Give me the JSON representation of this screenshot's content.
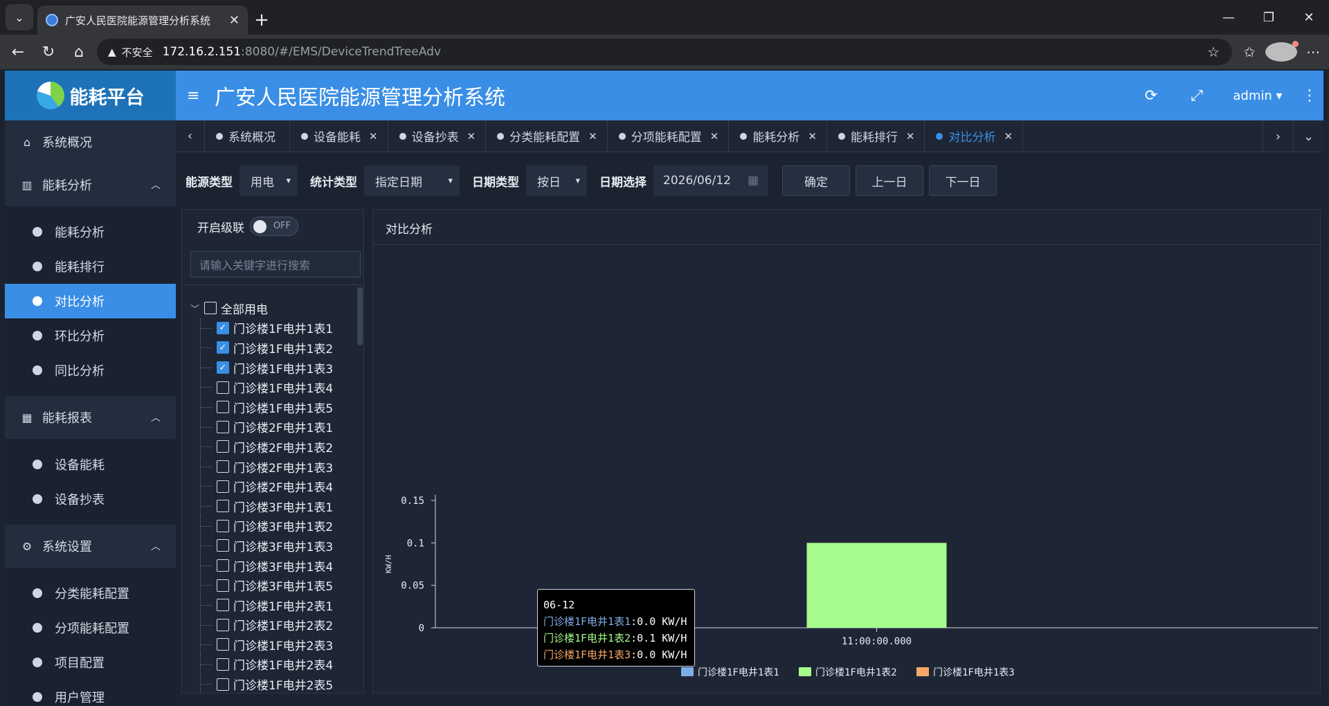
{
  "browser": {
    "tab_title": "广安人民医院能源管理分析系统",
    "insecure_label": "不安全",
    "url_host": "172.16.2.151",
    "url_path": ":8080/#/EMS/DeviceTrendTreeAdv"
  },
  "app": {
    "logo_text": "能耗平台",
    "system_name": "广安人民医院能源管理分析系统",
    "user": "admin"
  },
  "sidebar": {
    "overview": "系统概况",
    "groups": [
      {
        "label": "能耗分析",
        "icon": "bar-chart-icon",
        "items": [
          "能耗分析",
          "能耗排行",
          "对比分析",
          "环比分析",
          "同比分析"
        ],
        "active": "对比分析"
      },
      {
        "label": "能耗报表",
        "icon": "table-icon",
        "items": [
          "设备能耗",
          "设备抄表"
        ]
      },
      {
        "label": "系统设置",
        "icon": "gear-icon",
        "items": [
          "分类能耗配置",
          "分项能耗配置",
          "项目配置",
          "用户管理"
        ]
      }
    ]
  },
  "page_tabs": [
    "系统概况",
    "设备能耗",
    "设备抄表",
    "分类能耗配置",
    "分项能耗配置",
    "能耗分析",
    "能耗排行",
    "对比分析"
  ],
  "active_page_tab": "对比分析",
  "filter": {
    "energy_type_label": "能源类型",
    "energy_type": "用电",
    "stat_type_label": "统计类型",
    "stat_type": "指定日期",
    "date_type_label": "日期类型",
    "date_type": "按日",
    "date_label": "日期选择",
    "date": "2026/06/12",
    "confirm": "确定",
    "prev": "上一日",
    "next": "下一日"
  },
  "tree": {
    "cascade_label": "开启级联",
    "toggle": "OFF",
    "search_placeholder": "请输入关键字进行搜索",
    "root": "全部用电",
    "nodes": [
      {
        "label": "门诊楼1F电井1表1",
        "checked": true
      },
      {
        "label": "门诊楼1F电井1表2",
        "checked": true
      },
      {
        "label": "门诊楼1F电井1表3",
        "checked": true
      },
      {
        "label": "门诊楼1F电井1表4",
        "checked": false
      },
      {
        "label": "门诊楼1F电井1表5",
        "checked": false
      },
      {
        "label": "门诊楼2F电井1表1",
        "checked": false
      },
      {
        "label": "门诊楼2F电井1表2",
        "checked": false
      },
      {
        "label": "门诊楼2F电井1表3",
        "checked": false
      },
      {
        "label": "门诊楼2F电井1表4",
        "checked": false
      },
      {
        "label": "门诊楼3F电井1表1",
        "checked": false
      },
      {
        "label": "门诊楼3F电井1表2",
        "checked": false
      },
      {
        "label": "门诊楼3F电井1表3",
        "checked": false
      },
      {
        "label": "门诊楼3F电井1表4",
        "checked": false
      },
      {
        "label": "门诊楼3F电井1表5",
        "checked": false
      },
      {
        "label": "门诊楼1F电井2表1",
        "checked": false
      },
      {
        "label": "门诊楼1F电井2表2",
        "checked": false
      },
      {
        "label": "门诊楼1F电井2表3",
        "checked": false
      },
      {
        "label": "门诊楼1F电井2表4",
        "checked": false
      },
      {
        "label": "门诊楼1F电井2表5",
        "checked": false
      }
    ]
  },
  "chart_panel_title": "对比分析",
  "chart_data": {
    "type": "bar",
    "ylabel": "KW/H",
    "ylim": [
      0,
      0.15
    ],
    "yticks": [
      "0",
      "0.05",
      "0.1",
      "0.15"
    ],
    "categories": [
      "11:00:00.000"
    ],
    "series": [
      {
        "name": "门诊楼1F电井1表1",
        "values": [
          0.0
        ],
        "color": "#7eaee8"
      },
      {
        "name": "门诊楼1F电井1表2",
        "values": [
          0.1
        ],
        "color": "#a6fb8c"
      },
      {
        "name": "门诊楼1F电井1表3",
        "values": [
          0.0
        ],
        "color": "#f6a868"
      }
    ],
    "legend_position": "bottom"
  },
  "tooltip": {
    "header": "06-12",
    "lines": [
      {
        "name": "门诊楼1F电井1表1",
        "value": "0.0 KW/H",
        "color": "#7eaee8"
      },
      {
        "name": "门诊楼1F电井1表2",
        "value": "0.1 KW/H",
        "color": "#a6fb8c"
      },
      {
        "name": "门诊楼1F电井1表3",
        "value": "0.0 KW/H",
        "color": "#f6a868"
      }
    ]
  }
}
